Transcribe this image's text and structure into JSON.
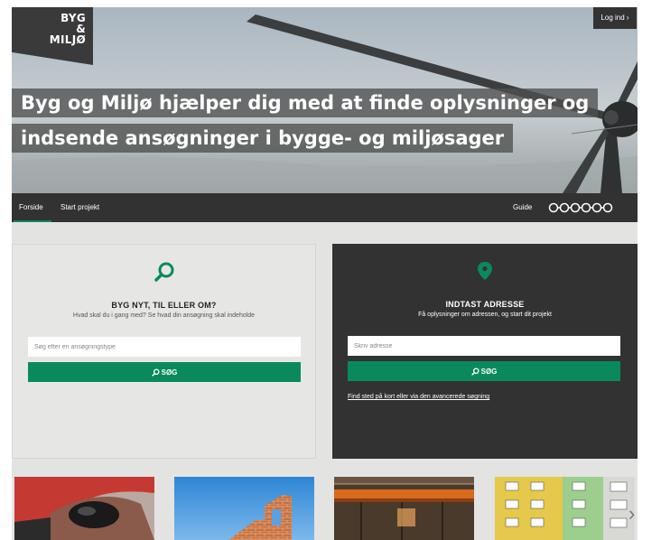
{
  "brand": {
    "logo_lines": [
      "BYG",
      "&",
      "MILJØ"
    ]
  },
  "header": {
    "login_label": "Log ind ›",
    "headline_lines": [
      "Byg og Miljø hjælper dig med at finde oplysninger og",
      "indsende ansøgninger i bygge- og miljøsager"
    ]
  },
  "nav": {
    "items": [
      {
        "label": "Forside",
        "active": true
      },
      {
        "label": "Start projekt",
        "active": false
      }
    ],
    "guide_label": "Guide",
    "guide_steps": 6
  },
  "left_panel": {
    "icon": "search-icon",
    "title": "BYG NYT, TIL ELLER OM?",
    "subtitle": "Hvad skal du i gang med? Se hvad din ansøgning skal indeholde",
    "input_placeholder": "Søg efter en ansøgningstype",
    "input_value": "",
    "button_label": "SØG"
  },
  "right_panel": {
    "icon": "location-pin-icon",
    "title": "INDTAST ADRESSE",
    "subtitle": "Få oplysninger om adressen, og start dit projekt",
    "input_placeholder": "Skriv adresse",
    "input_value": "",
    "button_label": "SØG",
    "link_label": "Find sted på kort eller via den avancerede søgning"
  },
  "thumbnails": [
    {
      "icon": "computer-mouse-image"
    },
    {
      "icon": "brick-wall-image"
    },
    {
      "icon": "factory-hall-image"
    },
    {
      "icon": "apartment-building-image"
    }
  ],
  "colors": {
    "accent_green": "#0a8a5c",
    "dark": "#323232",
    "panel_light": "#e6e7e5"
  }
}
